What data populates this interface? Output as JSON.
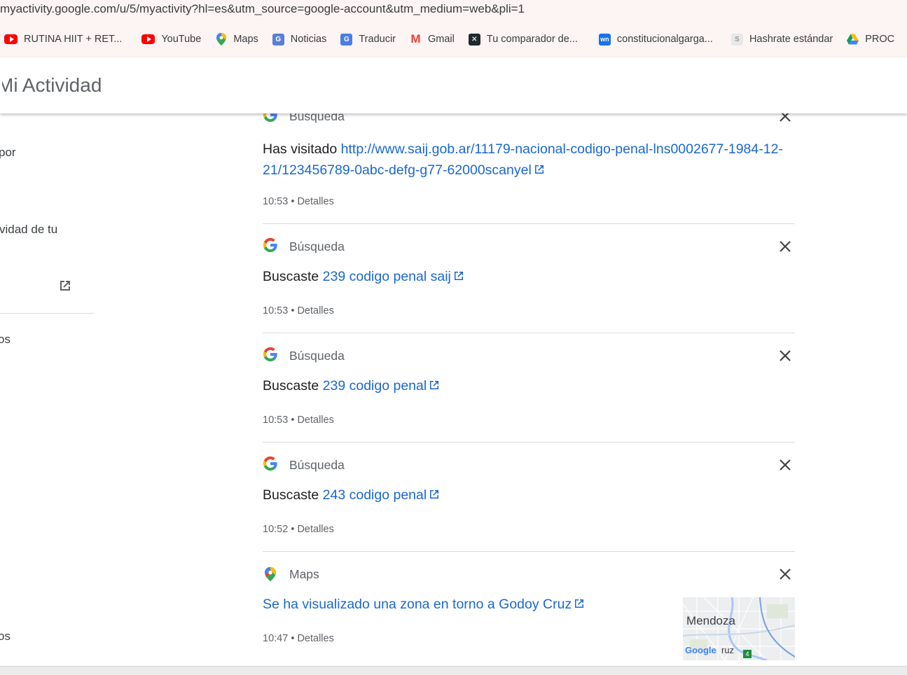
{
  "browser": {
    "url": "myactivity.google.com/u/5/myactivity?hl=es&utm_source=google-account&utm_medium=web&pli=1",
    "bookmarks": [
      {
        "label": "RUTINA HIIT + RET...",
        "icon": "youtube-icon"
      },
      {
        "label": "YouTube",
        "icon": "youtube-icon"
      },
      {
        "label": "Maps",
        "icon": "maps-pin-icon"
      },
      {
        "label": "Noticias",
        "icon": "news-icon"
      },
      {
        "label": "Traducir",
        "icon": "translate-icon"
      },
      {
        "label": "Gmail",
        "icon": "gmail-icon"
      },
      {
        "label": "Tu comparador de...",
        "icon": "comparator-icon"
      },
      {
        "label": "constitucionalgarga...",
        "icon": "wn-icon"
      },
      {
        "label": "Hashrate estándar",
        "icon": "hashrate-icon"
      },
      {
        "label": "PROC",
        "icon": "drive-icon"
      }
    ]
  },
  "header": {
    "title": "Mi Actividad"
  },
  "sidebar": {
    "fragments": [
      "por",
      "vidad de tu",
      "os",
      "os"
    ]
  },
  "colors": {
    "link": "#1a67d2",
    "muted": "#5f6368",
    "divider": "#dadce0"
  },
  "activity": [
    {
      "product": "Búsqueda",
      "prefix": "Has visitado",
      "link": "http://www.saij.gob.ar/11179-nacional-codigo-penal-lns0002677-1984-12-21/123456789-0abc-defg-g77-62000scanyel",
      "time": "10:53",
      "details": "Detalles"
    },
    {
      "product": "Búsqueda",
      "prefix": "Buscaste",
      "link": "239 codigo penal saij",
      "time": "10:53",
      "details": "Detalles"
    },
    {
      "product": "Búsqueda",
      "prefix": "Buscaste",
      "link": "239 codigo penal",
      "time": "10:53",
      "details": "Detalles"
    },
    {
      "product": "Búsqueda",
      "prefix": "Buscaste",
      "link": "243 codigo penal",
      "time": "10:52",
      "details": "Detalles"
    },
    {
      "product": "Maps",
      "prefix": "",
      "link": "Se ha visualizado una zona en torno a Godoy Cruz",
      "time": "10:47",
      "details": "Detalles",
      "map_labels": {
        "city": "Mendoza",
        "logo": "Google",
        "area": "ruz",
        "road": "4"
      }
    }
  ],
  "separator": "•"
}
